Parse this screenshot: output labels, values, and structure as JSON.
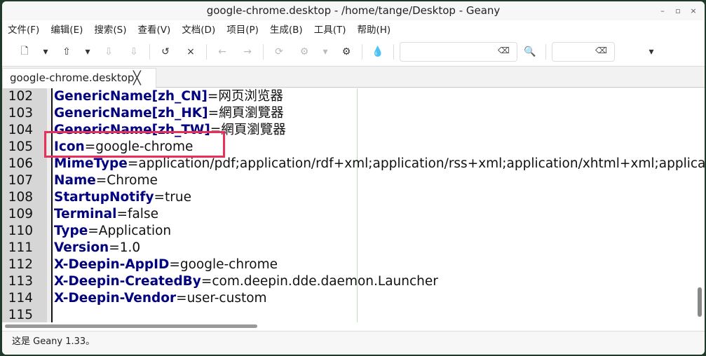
{
  "window": {
    "title": "google-chrome.desktop - /home/tange/Desktop - Geany",
    "min": "–",
    "max": "▫",
    "close": "×"
  },
  "menu": [
    "文件(F)",
    "编辑(E)",
    "搜索(S)",
    "查看(V)",
    "文档(D)",
    "项目(P)",
    "生成(B)",
    "工具(T)",
    "帮助(H)"
  ],
  "toolbar": {
    "new": "🗋",
    "dd": "▾",
    "open": "⇧",
    "save": "⇩",
    "saveall": "⇩",
    "revert": "↺",
    "close": "×",
    "back": "←",
    "fwd": "→",
    "reload": "⟳",
    "build": "⚙",
    "run": "⚙",
    "color": "💧",
    "clear": "⌫",
    "search": "🔍",
    "more": "▾"
  },
  "tab": {
    "label": "google-chrome.desktop",
    "close": "╳"
  },
  "lines": [
    {
      "n": "102",
      "k": "GenericName[zh_CN]",
      "v": "=网页浏览器"
    },
    {
      "n": "103",
      "k": "GenericName[zh_HK]",
      "v": "=網頁瀏覽器"
    },
    {
      "n": "104",
      "k": "GenericName[zh_TW]",
      "v": "=網頁瀏覽器"
    },
    {
      "n": "105",
      "k": "Icon",
      "v": "=google-chrome"
    },
    {
      "n": "106",
      "k": "MimeType",
      "v": "=application/pdf;application/rdf+xml;application/rss+xml;application/xhtml+xml;application/xhtml_xml;"
    },
    {
      "n": "107",
      "k": "Name",
      "v": "=Chrome"
    },
    {
      "n": "108",
      "k": "StartupNotify",
      "v": "=true"
    },
    {
      "n": "109",
      "k": "Terminal",
      "v": "=false"
    },
    {
      "n": "110",
      "k": "Type",
      "v": "=Application"
    },
    {
      "n": "111",
      "k": "Version",
      "v": "=1.0"
    },
    {
      "n": "112",
      "k": "X-Deepin-AppID",
      "v": "=google-chrome"
    },
    {
      "n": "113",
      "k": "X-Deepin-CreatedBy",
      "v": "=com.deepin.dde.daemon.Launcher"
    },
    {
      "n": "114",
      "k": "X-Deepin-Vendor",
      "v": "=user-custom"
    },
    {
      "n": "115",
      "k": "",
      "v": ""
    }
  ],
  "status": "这是 Geany 1.33。"
}
